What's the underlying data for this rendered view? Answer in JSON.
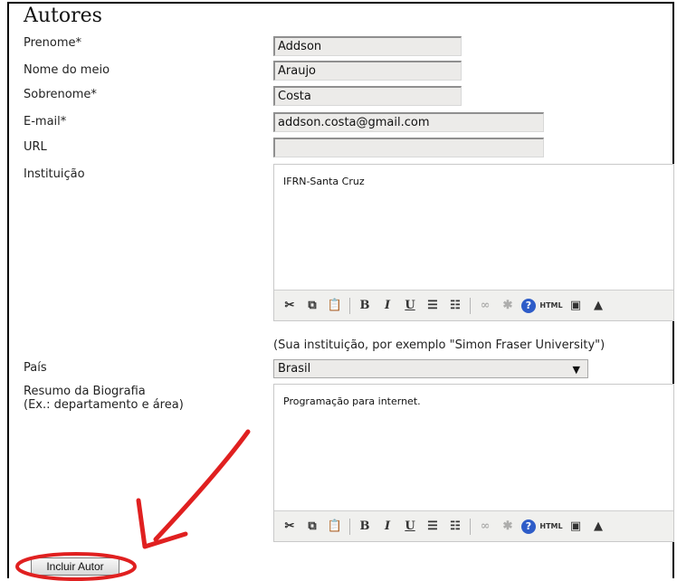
{
  "section_title": "Autores",
  "fields": {
    "first_name": {
      "label": "Prenome*",
      "value": "Addson"
    },
    "middle_name": {
      "label": "Nome do meio",
      "value": "Araujo"
    },
    "last_name": {
      "label": "Sobrenome*",
      "value": "Costa"
    },
    "email": {
      "label": "E-mail*",
      "value": "addson.costa@gmail.com"
    },
    "url": {
      "label": "URL",
      "value": ""
    },
    "institution": {
      "label": "Instituição",
      "value": "IFRN-Santa Cruz",
      "hint": "(Sua instituição, por exemplo \"Simon Fraser University\")"
    },
    "country": {
      "label": "País",
      "value": "Brasil",
      "arrow": "▼"
    },
    "bio": {
      "label": "Resumo da Biografia",
      "label_line2": "(Ex.: departamento e área)",
      "value": "Programação para internet."
    }
  },
  "toolbar": {
    "icons": [
      "cut-icon",
      "copy-icon",
      "paste-icon",
      "bold-icon",
      "italic-icon",
      "underline-icon",
      "bullet-list-icon",
      "numbered-list-icon",
      "link-icon",
      "unlink-icon",
      "help-icon",
      "html-icon",
      "fullscreen-icon",
      "image-icon"
    ],
    "bold": "B",
    "italic": "I",
    "underline": "U",
    "help": "?",
    "html": "HTML"
  },
  "submit_button": "Incluir Autor",
  "annotation_color": "#e02020"
}
